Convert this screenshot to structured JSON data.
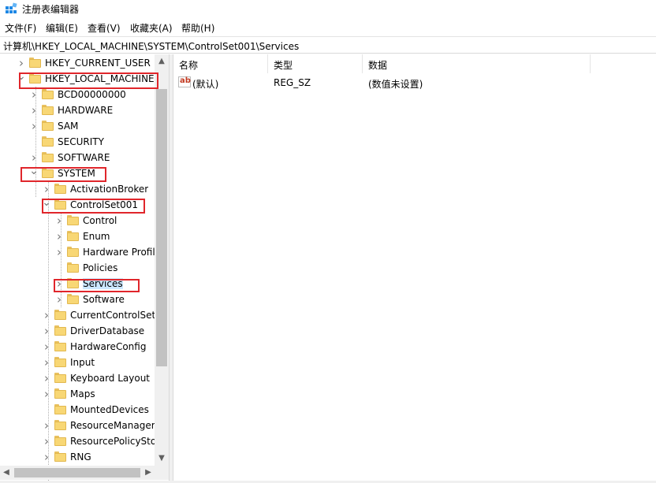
{
  "window": {
    "title": "注册表编辑器",
    "icon": "regedit-icon"
  },
  "menu": [
    {
      "label": "文件(F)"
    },
    {
      "label": "编辑(E)"
    },
    {
      "label": "查看(V)"
    },
    {
      "label": "收藏夹(A)"
    },
    {
      "label": "帮助(H)"
    }
  ],
  "address": {
    "path": "计算机\\HKEY_LOCAL_MACHINE\\SYSTEM\\ControlSet001\\Services"
  },
  "tree": [
    {
      "label": "HKEY_CURRENT_USER",
      "level": 0,
      "expander": "collapsed"
    },
    {
      "label": "HKEY_LOCAL_MACHINE",
      "level": 0,
      "expander": "expanded"
    },
    {
      "label": "BCD00000000",
      "level": 1,
      "expander": "collapsed"
    },
    {
      "label": "HARDWARE",
      "level": 1,
      "expander": "collapsed"
    },
    {
      "label": "SAM",
      "level": 1,
      "expander": "collapsed"
    },
    {
      "label": "SECURITY",
      "level": 1,
      "expander": "none"
    },
    {
      "label": "SOFTWARE",
      "level": 1,
      "expander": "collapsed"
    },
    {
      "label": "SYSTEM",
      "level": 1,
      "expander": "expanded"
    },
    {
      "label": "ActivationBroker",
      "level": 2,
      "expander": "collapsed"
    },
    {
      "label": "ControlSet001",
      "level": 2,
      "expander": "expanded"
    },
    {
      "label": "Control",
      "level": 3,
      "expander": "collapsed"
    },
    {
      "label": "Enum",
      "level": 3,
      "expander": "collapsed"
    },
    {
      "label": "Hardware Profil",
      "level": 3,
      "expander": "collapsed"
    },
    {
      "label": "Policies",
      "level": 3,
      "expander": "none"
    },
    {
      "label": "Services",
      "level": 3,
      "expander": "collapsed",
      "selected": true
    },
    {
      "label": "Software",
      "level": 3,
      "expander": "collapsed"
    },
    {
      "label": "CurrentControlSet",
      "level": 2,
      "expander": "collapsed"
    },
    {
      "label": "DriverDatabase",
      "level": 2,
      "expander": "collapsed"
    },
    {
      "label": "HardwareConfig",
      "level": 2,
      "expander": "collapsed"
    },
    {
      "label": "Input",
      "level": 2,
      "expander": "collapsed"
    },
    {
      "label": "Keyboard Layout",
      "level": 2,
      "expander": "collapsed"
    },
    {
      "label": "Maps",
      "level": 2,
      "expander": "collapsed"
    },
    {
      "label": "MountedDevices",
      "level": 2,
      "expander": "none"
    },
    {
      "label": "ResourceManager",
      "level": 2,
      "expander": "collapsed"
    },
    {
      "label": "ResourcePolicySto",
      "level": 2,
      "expander": "collapsed"
    },
    {
      "label": "RNG",
      "level": 2,
      "expander": "collapsed"
    }
  ],
  "list": {
    "columns": [
      {
        "label": "名称"
      },
      {
        "label": "类型"
      },
      {
        "label": "数据"
      }
    ],
    "rows": [
      {
        "icon": "string-value-icon",
        "icon_text": "ab",
        "name": "(默认)",
        "type": "REG_SZ",
        "data": "(数值未设置)"
      }
    ]
  },
  "highlight_color": "#e0262b",
  "selection_color": "#cce8ff"
}
